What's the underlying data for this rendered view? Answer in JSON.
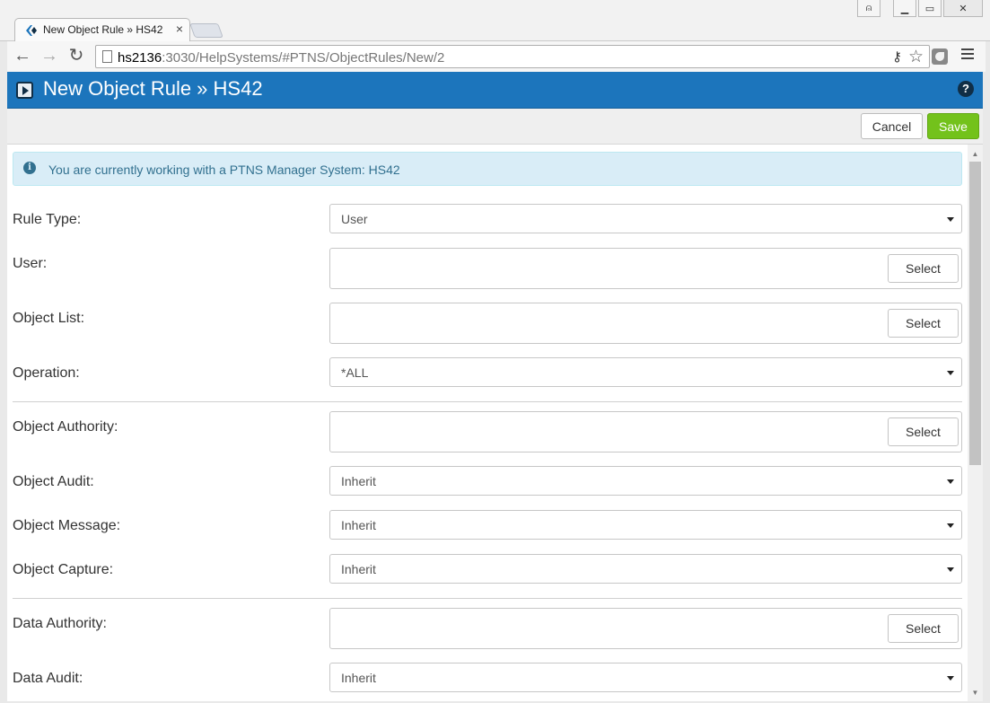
{
  "browser": {
    "tab_title": "New Object Rule » HS42",
    "tab_close": "×",
    "url_host": "hs2136",
    "url_rest": ":3030/HelpSystems/#PTNS/ObjectRules/New/2",
    "back_glyph": "←",
    "forward_glyph": "→",
    "reload_glyph": "↻",
    "key_glyph": "⚷",
    "star_glyph": "☆",
    "win_profile_glyph": "⍝",
    "win_min_glyph": "▁",
    "win_max_glyph": "▭",
    "win_close_glyph": "✕"
  },
  "header": {
    "title": "New Object Rule » HS42",
    "help_glyph": "?",
    "color": "#1c75bc"
  },
  "actions": {
    "cancel_label": "Cancel",
    "save_label": "Save",
    "save_color": "#73c21b"
  },
  "alert": {
    "icon_glyph": "i",
    "text": "You are currently working with a PTNS Manager System: HS42"
  },
  "form": {
    "rule_type": {
      "label": "Rule Type:",
      "value": "User"
    },
    "user": {
      "label": "User:",
      "button": "Select"
    },
    "object_list": {
      "label": "Object List:",
      "button": "Select"
    },
    "operation": {
      "label": "Operation:",
      "value": "*ALL"
    },
    "object_authority": {
      "label": "Object Authority:",
      "button": "Select"
    },
    "object_audit": {
      "label": "Object Audit:",
      "value": "Inherit"
    },
    "object_message": {
      "label": "Object Message:",
      "value": "Inherit"
    },
    "object_capture": {
      "label": "Object Capture:",
      "value": "Inherit"
    },
    "data_authority": {
      "label": "Data Authority:",
      "button": "Select"
    },
    "data_audit": {
      "label": "Data Audit:",
      "value": "Inherit"
    }
  },
  "scrollbar": {
    "up_glyph": "▲",
    "down_glyph": "▼"
  }
}
